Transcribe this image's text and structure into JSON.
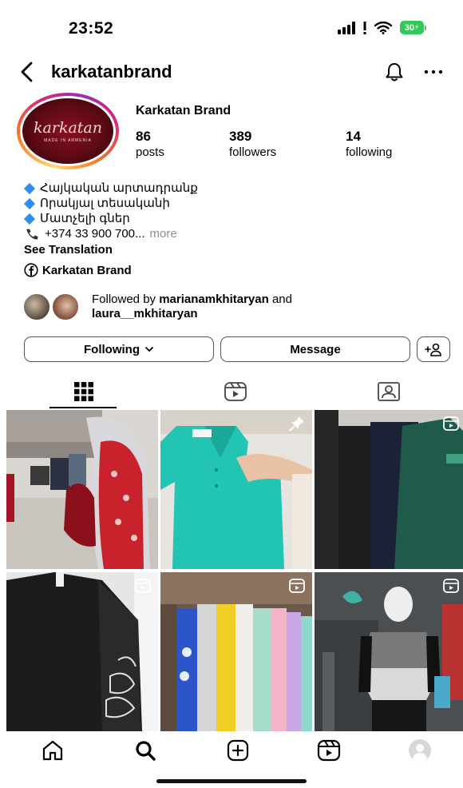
{
  "status_bar": {
    "time": "23:52",
    "battery": "30"
  },
  "header": {
    "username": "karkatanbrand"
  },
  "profile": {
    "avatar_logo": "karkatan",
    "avatar_tagline": "MADE IN ARMENIA",
    "display_name": "Karkatan Brand",
    "stats": [
      {
        "value": "86",
        "label": "posts"
      },
      {
        "value": "389",
        "label": "followers"
      },
      {
        "value": "14",
        "label": "following"
      }
    ],
    "bio_lines": [
      "Հայկական արտադրանք",
      "Որակյալ տեսականի",
      "Մատչելի գներ"
    ],
    "phone": "+374 33 900 700...",
    "more_label": "more",
    "see_translation": "See Translation",
    "facebook_link": "Karkatan Brand",
    "followed_by": {
      "prefix": "Followed by",
      "user1": "marianamkhitaryan",
      "joiner": "and",
      "user2": "laura__mkhitaryan"
    }
  },
  "actions": {
    "following": "Following",
    "message": "Message"
  },
  "tabs": [
    {
      "name": "posts-grid",
      "icon": "grid-icon",
      "active": true
    },
    {
      "name": "reels",
      "icon": "reels-icon",
      "active": false
    },
    {
      "name": "tagged",
      "icon": "tagged-icon",
      "active": false
    }
  ],
  "grid": [
    {
      "subject": "santa-costume-street",
      "badge": ""
    },
    {
      "subject": "teal-polo-shirt",
      "badge": "pin-icon"
    },
    {
      "subject": "dark-sweatshirts",
      "badge": "reel-icon"
    },
    {
      "subject": "black-sweater-leaf-print",
      "badge": "reel-icon"
    },
    {
      "subject": "colorful-hoodies-rack",
      "badge": "reel-icon"
    },
    {
      "subject": "kids-plaid-jacket-mannequin",
      "badge": "reel-icon"
    }
  ],
  "colors": {
    "accent_blue": "#2f8ef0",
    "battery_green": "#34c759",
    "muted_text": "#8e8e8e"
  },
  "bottom_nav": [
    "home-icon",
    "search-icon",
    "create-icon",
    "reels-icon",
    "profile-icon"
  ]
}
